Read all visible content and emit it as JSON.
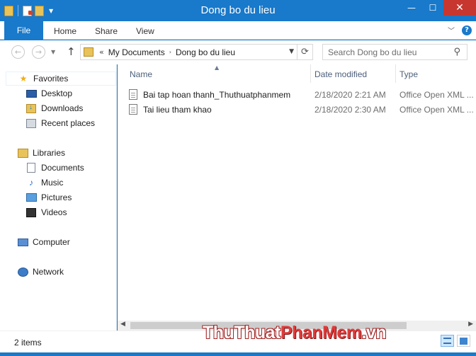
{
  "window": {
    "title": "Dong bo du lieu"
  },
  "ribbon": {
    "tabs": [
      "File",
      "Home",
      "Share",
      "View"
    ]
  },
  "address": {
    "overflow": "«",
    "segments": [
      "My Documents",
      "Dong bo du lieu"
    ]
  },
  "search": {
    "placeholder": "Search Dong bo du lieu"
  },
  "sidebar": {
    "favorites": {
      "label": "Favorites",
      "items": [
        "Desktop",
        "Downloads",
        "Recent places"
      ]
    },
    "libraries": {
      "label": "Libraries",
      "items": [
        "Documents",
        "Music",
        "Pictures",
        "Videos"
      ]
    },
    "computer": "Computer",
    "network": "Network"
  },
  "columns": {
    "name": "Name",
    "date": "Date modified",
    "type": "Type"
  },
  "files": [
    {
      "name": "Bai tap hoan thanh_Thuthuatphanmem",
      "date": "2/18/2020 2:21 AM",
      "type": "Office Open XML ..."
    },
    {
      "name": "Tai lieu tham khao",
      "date": "2/18/2020 2:30 AM",
      "type": "Office Open XML ..."
    }
  ],
  "status": {
    "item_count": "2 items"
  },
  "watermark": {
    "part1": "ThuThuat",
    "part2": "PhanMem",
    "part3": ".vn"
  },
  "colors": {
    "accent": "#1979ca",
    "close": "#c7372f"
  }
}
